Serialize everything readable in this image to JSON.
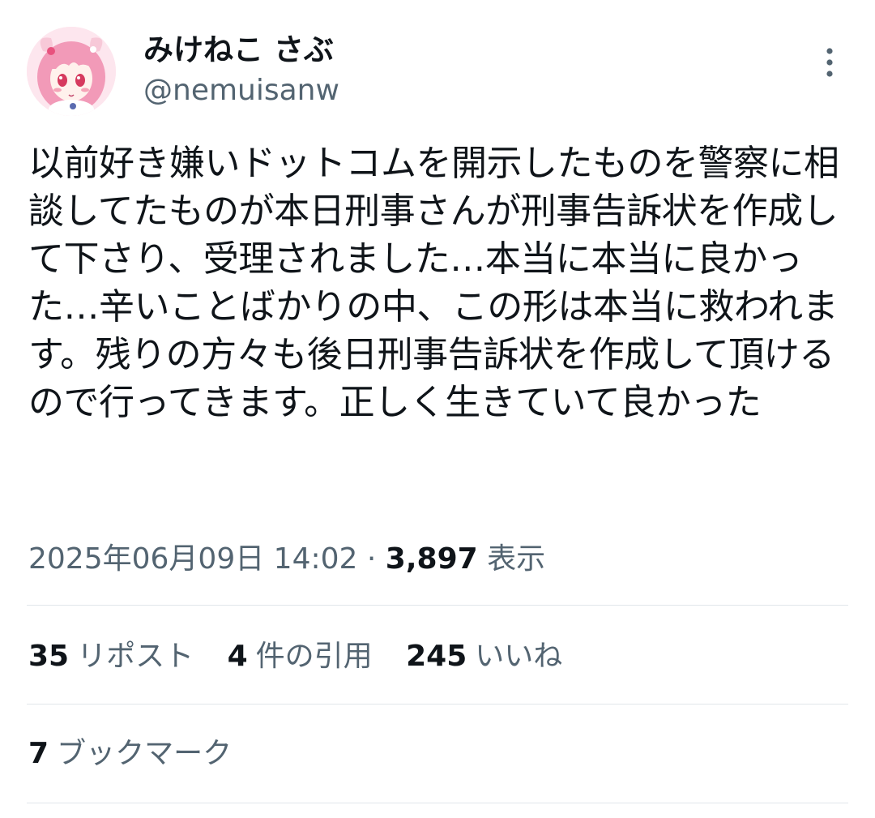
{
  "author": {
    "display_name": "みけねこ さぶ",
    "handle": "@nemuisanw",
    "avatar_icon": "anime-girl-avatar"
  },
  "menu_icon": "more-vertical-icon",
  "tweet": {
    "text": "以前好き嫌いドットコムを開示したものを警察に相談してたものが本日刑事さんが刑事告訴状を作成して下さり、受理されました…本当に本当に良かった…辛いことばかりの中、この形は本当に救われます。残りの方々も後日刑事告訴状を作成して頂けるので行ってきます。正しく生きていて良かった",
    "timestamp": "2025年06月09日 14:02",
    "separator": "·",
    "views_count": "3,897",
    "views_label": "表示"
  },
  "stats": {
    "reposts": {
      "count": "35",
      "label": "リポスト"
    },
    "quotes": {
      "count": "4",
      "label": "件の引用"
    },
    "likes": {
      "count": "245",
      "label": "いいね"
    },
    "bookmarks": {
      "count": "7",
      "label": "ブックマーク"
    }
  },
  "colors": {
    "text_primary": "#0f1419",
    "text_secondary": "#536471",
    "divider": "#e1e6ea",
    "avatar_background": "#fde6ee",
    "avatar_hair": "#f29ab8"
  }
}
